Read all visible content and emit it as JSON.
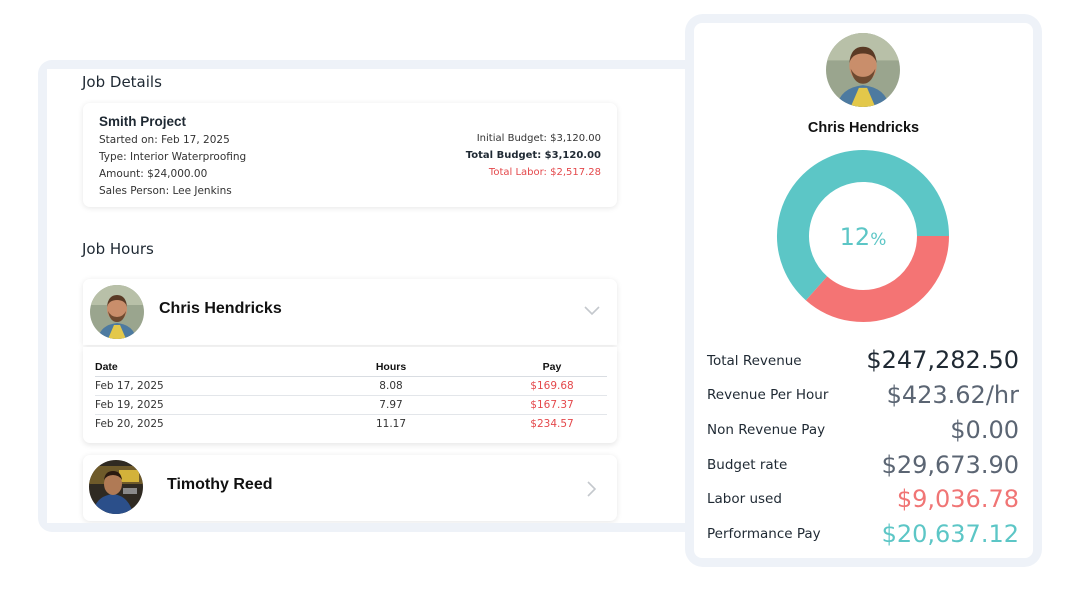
{
  "job_details": {
    "title": "Job Details",
    "project_name": "Smith Project",
    "started_on": "Started on: Feb 17, 2025",
    "type": "Type: Interior Waterproofing",
    "amount": "Amount: $24,000.00",
    "sales_person": "Sales Person: Lee Jenkins",
    "initial_budget": "Initial Budget: $3,120.00",
    "total_budget": "Total Budget: $3,120.00",
    "total_labor": "Total Labor: $2,517.28"
  },
  "job_hours": {
    "title": "Job Hours",
    "columns": [
      "Date",
      "Hours",
      "Pay"
    ],
    "employees": [
      {
        "name": "Chris Hendricks",
        "expanded": true,
        "rows": [
          {
            "date": "Feb 17, 2025",
            "hours": "8.08",
            "pay": "$169.68"
          },
          {
            "date": "Feb 19, 2025",
            "hours": "7.97",
            "pay": "$167.37"
          },
          {
            "date": "Feb 20, 2025",
            "hours": "11.17",
            "pay": "$234.57"
          }
        ]
      },
      {
        "name": "Timothy Reed",
        "expanded": false
      }
    ]
  },
  "profile": {
    "name": "Chris Hendricks",
    "percent_value": 12,
    "percent_number": "12",
    "percent_sign": "%",
    "donut_fraction_labor": 0.3655,
    "colors": {
      "teal": "#5cc6c6",
      "red": "#f47474"
    },
    "stats": [
      {
        "label": "Total Revenue",
        "value": "$247,282.50"
      },
      {
        "label": "Revenue Per Hour",
        "value": "$423.62/hr"
      },
      {
        "label": "Non Revenue Pay",
        "value": "$0.00"
      },
      {
        "label": "Budget rate",
        "value": "$29,673.90"
      },
      {
        "label": "Labor used",
        "value": "$9,036.78"
      },
      {
        "label": "Performance Pay",
        "value": "$20,637.12"
      }
    ]
  }
}
